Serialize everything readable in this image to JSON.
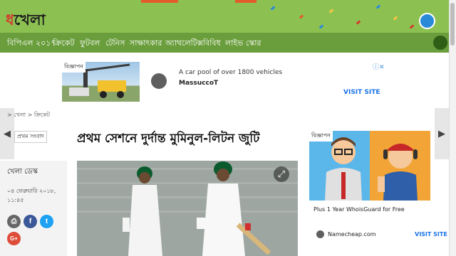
{
  "site": {
    "logo_mark": "ধ",
    "logo_text": "খেলা"
  },
  "nav": {
    "items": [
      "বিপিএল ২০১৭",
      "ক্রিকেট",
      "ফুটবল",
      "টেনিস",
      "সাক্ষাৎকার",
      "অ্যাথলেটিক্স",
      "বিবিধ",
      "লাইভ স্কোর"
    ]
  },
  "ad_top": {
    "label": "বিজ্ঞাপন",
    "title": "A car pool of over 1800 vehicles",
    "advertiser": "MassuccoT",
    "cta": "VISIT SITE",
    "choices_icon": "adchoices-icon"
  },
  "breadcrumb": {
    "home": "খেলা",
    "section": "ক্রিকেট",
    "separator": ">"
  },
  "article": {
    "tag": "প্রথম সংবাদ",
    "headline": "প্রথম সেশনে দুর্দান্ত মুমিনুল-লিটন জুটি",
    "author": "খেলা ডেস্ক",
    "date": "০৪ ফেব্রুয়ারি ২০১৮, ১১:৪৫"
  },
  "share": {
    "print": "print-icon",
    "facebook": "f",
    "twitter": "t",
    "google": "G+"
  },
  "ad_right": {
    "label": "বিজ্ঞাপন",
    "text": "Plus 1 Year WhoisGuard for Free",
    "domain": "Namecheap.com",
    "cta": "VISIT SITE"
  },
  "arrows": {
    "prev": "◀",
    "next": "▶"
  },
  "colors": {
    "header_green": "#8cc152",
    "nav_green": "#6a9e3c",
    "facebook": "#3b5998",
    "twitter": "#1da1f2",
    "google": "#dd4b39",
    "link_blue": "#1a73e8"
  }
}
